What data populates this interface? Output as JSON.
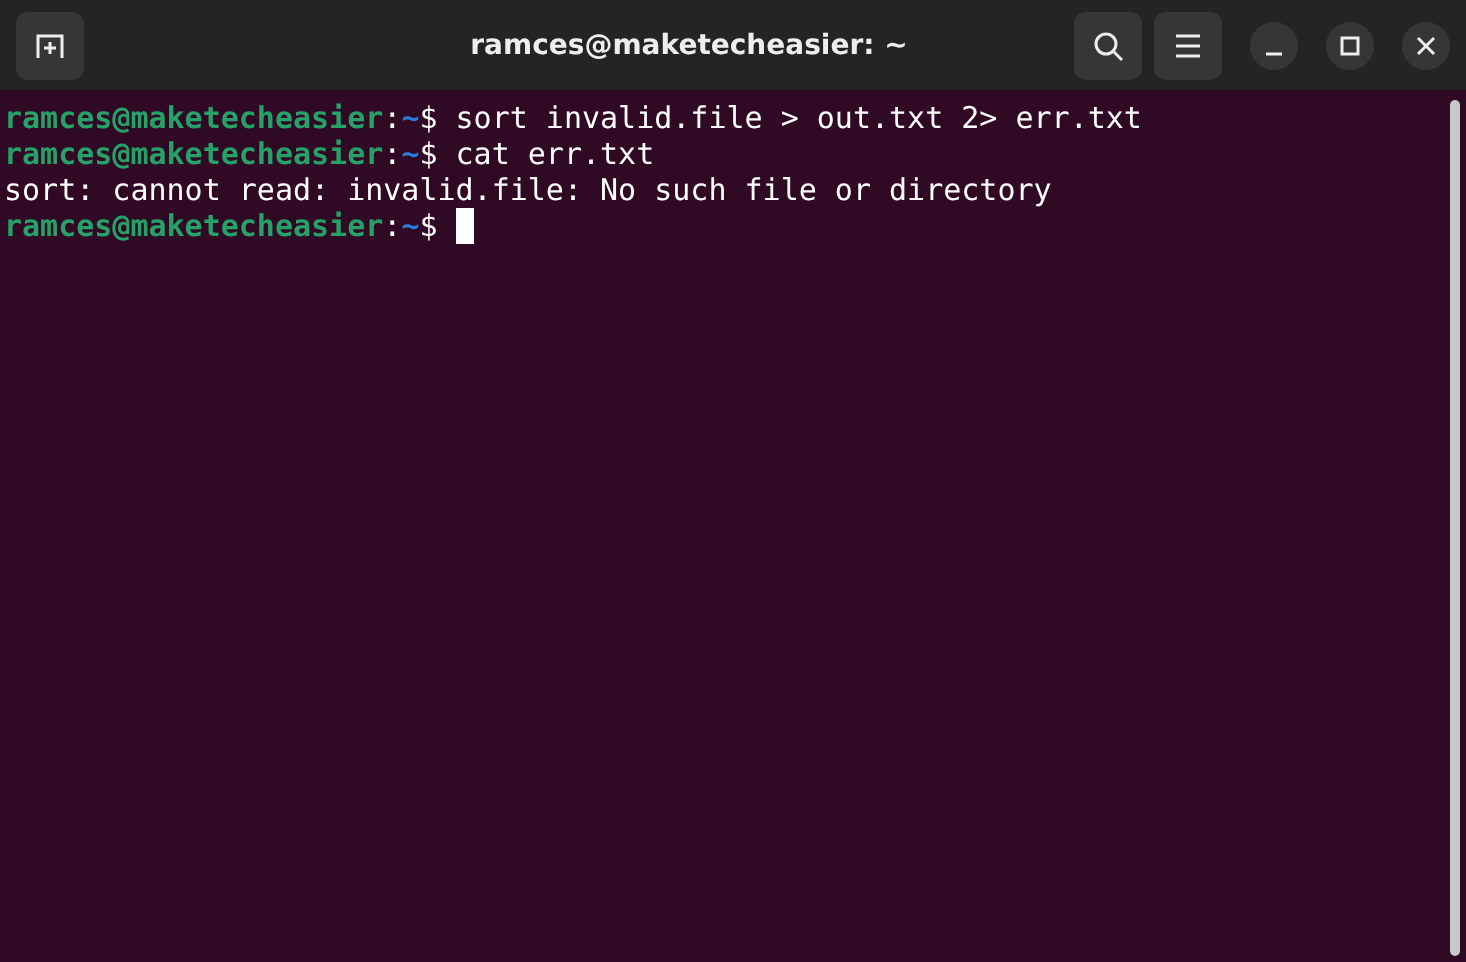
{
  "window": {
    "title": "ramces@maketecheasier: ~"
  },
  "lines": [
    {
      "kind": "prompt",
      "user_host": "ramces@maketecheasier",
      "separator": ":",
      "path": "~",
      "symbol": "$",
      "command": "sort invalid.file > out.txt 2> err.txt",
      "cursor": false
    },
    {
      "kind": "prompt",
      "user_host": "ramces@maketecheasier",
      "separator": ":",
      "path": "~",
      "symbol": "$",
      "command": "cat err.txt",
      "cursor": false
    },
    {
      "kind": "output",
      "text": "sort: cannot read: invalid.file: No such file or directory"
    },
    {
      "kind": "prompt",
      "user_host": "ramces@maketecheasier",
      "separator": ":",
      "path": "~",
      "symbol": "$",
      "cursor": true
    }
  ]
}
